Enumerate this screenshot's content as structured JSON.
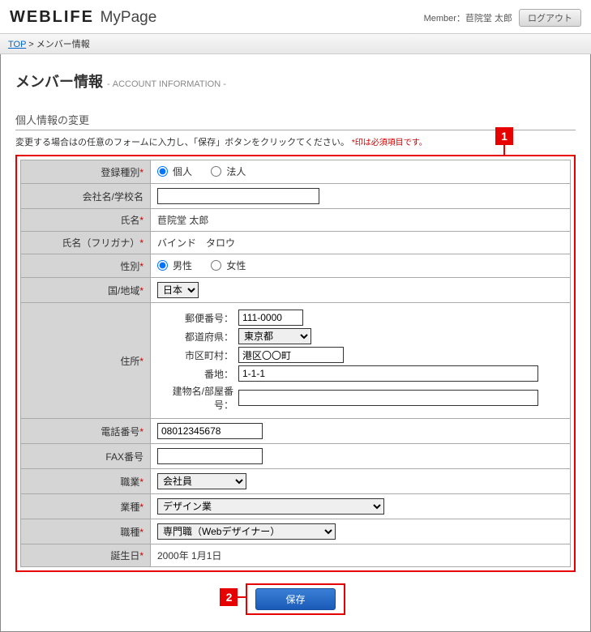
{
  "header": {
    "logo_bold": "WEBLIFE",
    "logo_light": "MyPage",
    "member_label": "Member：",
    "member_name": "苣院堂 太郎",
    "logout": "ログアウト"
  },
  "breadcrumb": {
    "top": "TOP",
    "sep": ">",
    "current": "メンバー情報"
  },
  "page": {
    "title": "メンバー情報",
    "subtitle": "- ACCOUNT INFORMATION -",
    "section_title": "個人情報の変更",
    "instruction": "変更する場合はの任意のフォームに入力し、「保存」ボタンをクリックてください。",
    "required_note": "*印は必須項目です。"
  },
  "markers": {
    "one": "1",
    "two": "2"
  },
  "form": {
    "reg_type": {
      "label": "登録種別",
      "opt1": "個人",
      "opt2": "法人",
      "value": "個人"
    },
    "company": {
      "label": "会社名/学校名",
      "value": ""
    },
    "name": {
      "label": "氏名",
      "value": "苣院堂 太郎"
    },
    "kana": {
      "label": "氏名（フリガナ）",
      "value": "バインド　タロウ"
    },
    "gender": {
      "label": "性別",
      "opt1": "男性",
      "opt2": "女性",
      "value": "男性"
    },
    "country": {
      "label": "国/地域",
      "value": "日本"
    },
    "address": {
      "label": "住所",
      "zip_label": "郵便番号：",
      "zip": "111-0000",
      "pref_label": "都道府県：",
      "pref": "東京都",
      "city_label": "市区町村：",
      "city": "港区〇〇町",
      "street_label": "番地：",
      "street": "1-1-1",
      "building_label": "建物名/部屋番号：",
      "building": ""
    },
    "tel": {
      "label": "電話番号",
      "value": "08012345678"
    },
    "fax": {
      "label": "FAX番号",
      "value": ""
    },
    "occupation": {
      "label": "職業",
      "value": "会社員"
    },
    "industry": {
      "label": "業種",
      "value": "デザイン業"
    },
    "jobtype": {
      "label": "職種",
      "value": "専門職（Webデザイナー）"
    },
    "birthday": {
      "label": "誕生日",
      "value": "2000年 1月1日"
    }
  },
  "save": {
    "label": "保存"
  }
}
